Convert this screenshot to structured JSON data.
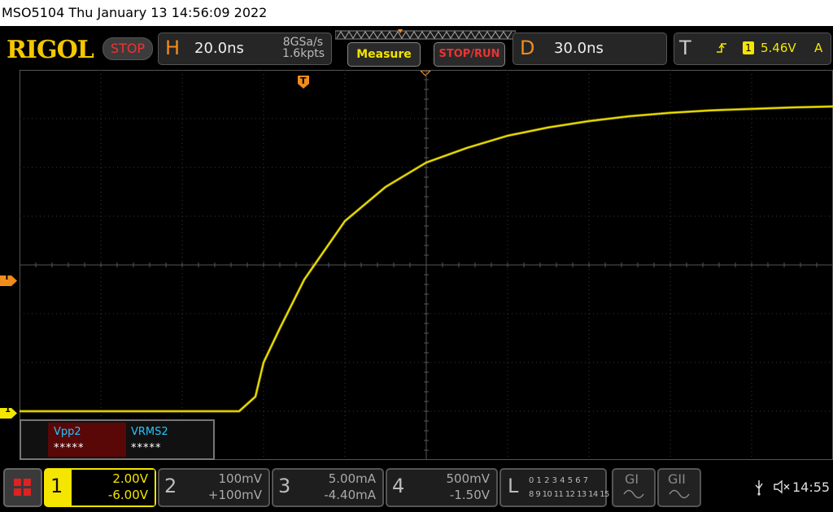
{
  "title_bar": "MSO5104  Thu January 13 14:56:09 2022",
  "brand": "RIGOL",
  "run_state": "STOP",
  "horizontal": {
    "letter": "H",
    "timebase": "20.0ns",
    "sample_rate": "8GSa/s",
    "memory_depth": "1.6kpts"
  },
  "buttons": {
    "measure": "Measure",
    "stop_run": "STOP/RUN"
  },
  "delay": {
    "letter": "D",
    "value": "30.0ns"
  },
  "trigger": {
    "letter": "T",
    "channel": "1",
    "level": "5.46V",
    "mode": "A"
  },
  "markers": {
    "trigger_level": "T",
    "channel1": "1",
    "trigger_pos": "T"
  },
  "measurements": [
    {
      "label": "Vpp2",
      "value": "*****"
    },
    {
      "label": "VRMS2",
      "value": "*****"
    }
  ],
  "channels": [
    {
      "num": "1",
      "scale": "2.00V",
      "offset": "-6.00V",
      "active": true
    },
    {
      "num": "2",
      "scale": "100mV",
      "offset": "+100mV",
      "active": false
    },
    {
      "num": "3",
      "scale": "5.00mA",
      "offset": "-4.40mA",
      "active": false
    },
    {
      "num": "4",
      "scale": "500mV",
      "offset": "-1.50V",
      "active": false
    }
  ],
  "logic": {
    "letter": "L",
    "row1": "0 1 2 3  4 5 6 7",
    "row2": "8 9 10 11 12 13 14 15"
  },
  "generators": [
    {
      "label": "GI"
    },
    {
      "label": "GII"
    }
  ],
  "clock": "14:55",
  "colors": {
    "ch1": "#f4e600",
    "trigger": "#f08c1c",
    "grid": "#3a3a3a"
  },
  "icons": [
    "menu-icon",
    "usb-icon",
    "speaker-muted-icon",
    "trigger-edge-icon"
  ],
  "chart_data": {
    "type": "line",
    "title": "",
    "xlabel": "",
    "ylabel": "",
    "x_divisions": 10,
    "y_divisions": 8,
    "series": [
      {
        "name": "1",
        "x_div": [
          0,
          1,
          2,
          2.7,
          2.9,
          3.0,
          3.2,
          3.5,
          4.0,
          4.5,
          5.0,
          5.5,
          6.0,
          6.5,
          7.0,
          7.5,
          8.0,
          8.5,
          9.0,
          9.5,
          10.0
        ],
        "y_div": [
          -3.0,
          -3.0,
          -3.0,
          -3.0,
          -2.7,
          -2.0,
          -1.3,
          -0.3,
          0.9,
          1.6,
          2.1,
          2.4,
          2.65,
          2.82,
          2.95,
          3.05,
          3.12,
          3.17,
          3.2,
          3.23,
          3.25
        ]
      }
    ]
  }
}
